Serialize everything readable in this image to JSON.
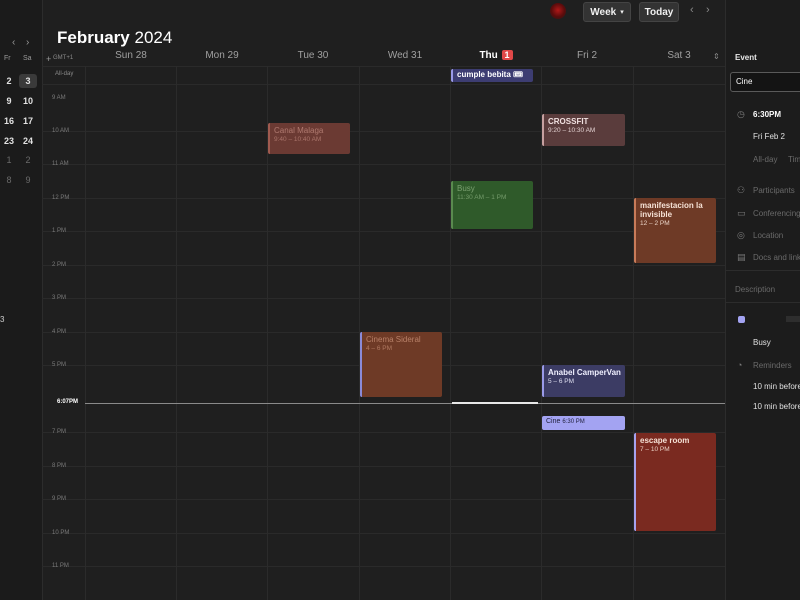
{
  "mini_calendar": {
    "nav_prev": "‹",
    "nav_next": "›",
    "weekday_labels": [
      "Fr",
      "Sa"
    ],
    "rows": [
      [
        "2",
        "3"
      ],
      [
        "9",
        "10"
      ],
      [
        "16",
        "17"
      ],
      [
        "23",
        "24"
      ],
      [
        "1",
        "2"
      ],
      [
        "8",
        "9"
      ]
    ],
    "side_mark": "3"
  },
  "toolbar": {
    "view_label": "Week",
    "today_label": "Today",
    "prev": "‹",
    "next": "›"
  },
  "header": {
    "month": "February",
    "year": "2024",
    "gmt": "GMT+1",
    "today_badge": "1"
  },
  "days": [
    {
      "name": "Sun 28"
    },
    {
      "name": "Mon 29"
    },
    {
      "name": "Tue 30"
    },
    {
      "name": "Wed 31"
    },
    {
      "name": "Thu"
    },
    {
      "name": "Fri 2"
    },
    {
      "name": "Sat 3"
    }
  ],
  "allday_label": "All-day",
  "hours": [
    "9 AM",
    "10 AM",
    "11 AM",
    "12 PM",
    "1 PM",
    "2 PM",
    "3 PM",
    "4 PM",
    "5 PM",
    "6 PM",
    "7 PM",
    "8 PM",
    "9 PM",
    "10 PM",
    "11 PM"
  ],
  "current_time": "6:07PM",
  "events": [
    {
      "title": "cumple bebita 🎟",
      "time": "",
      "color": "#3d3d72",
      "bar": "#9a9ae8"
    },
    {
      "title": "Canal Malaga",
      "time": "9:40 – 10:40 AM",
      "color": "#6b3a33",
      "bar": "#a05a4f"
    },
    {
      "title": "CROSSFIT",
      "time": "9:20 – 10:30 AM",
      "color": "#5a3c3c",
      "bar": "#c6a0a0"
    },
    {
      "title": "Busy",
      "time": "11:30 AM – 1 PM",
      "color": "#2f5a2a",
      "bar": "#5a8a4f"
    },
    {
      "title": "manifestacion la invisible",
      "time": "12 – 2 PM",
      "color": "#6e3a26",
      "bar": "#c87b59"
    },
    {
      "title": "Cinema Sideral",
      "time": "4 – 6 PM",
      "color": "#6e3a26",
      "bar": "#8a8ad8"
    },
    {
      "title": "Anabel CamperVan",
      "time": "5 – 6 PM",
      "color": "#3c3c64",
      "bar": "#9a9ae8"
    },
    {
      "title": "Cine",
      "time": "6:30 PM",
      "color": "#a3a3f2",
      "bar": "#a3a3f2"
    },
    {
      "title": "escape room",
      "time": "7 – 10 PM",
      "color": "#7a2a20",
      "bar": "#a6a2ee"
    }
  ],
  "panel": {
    "heading": "Event",
    "title_value": "Cine",
    "start_time": "6:30PM",
    "date": "Fri Feb 2",
    "allday": "All-day",
    "timezone": "Tim",
    "participants": "Participants",
    "conferencing": "Conferencing",
    "location": "Location",
    "docs": "Docs and links",
    "description": "Description",
    "status": "Busy",
    "reminders": "Reminders",
    "reminder_1": "10 min before",
    "reminder_2": "10 min before"
  },
  "colors": {
    "background": "#1f1f1f",
    "today_badge": "#e04848",
    "accent": "#a3a3f2"
  }
}
